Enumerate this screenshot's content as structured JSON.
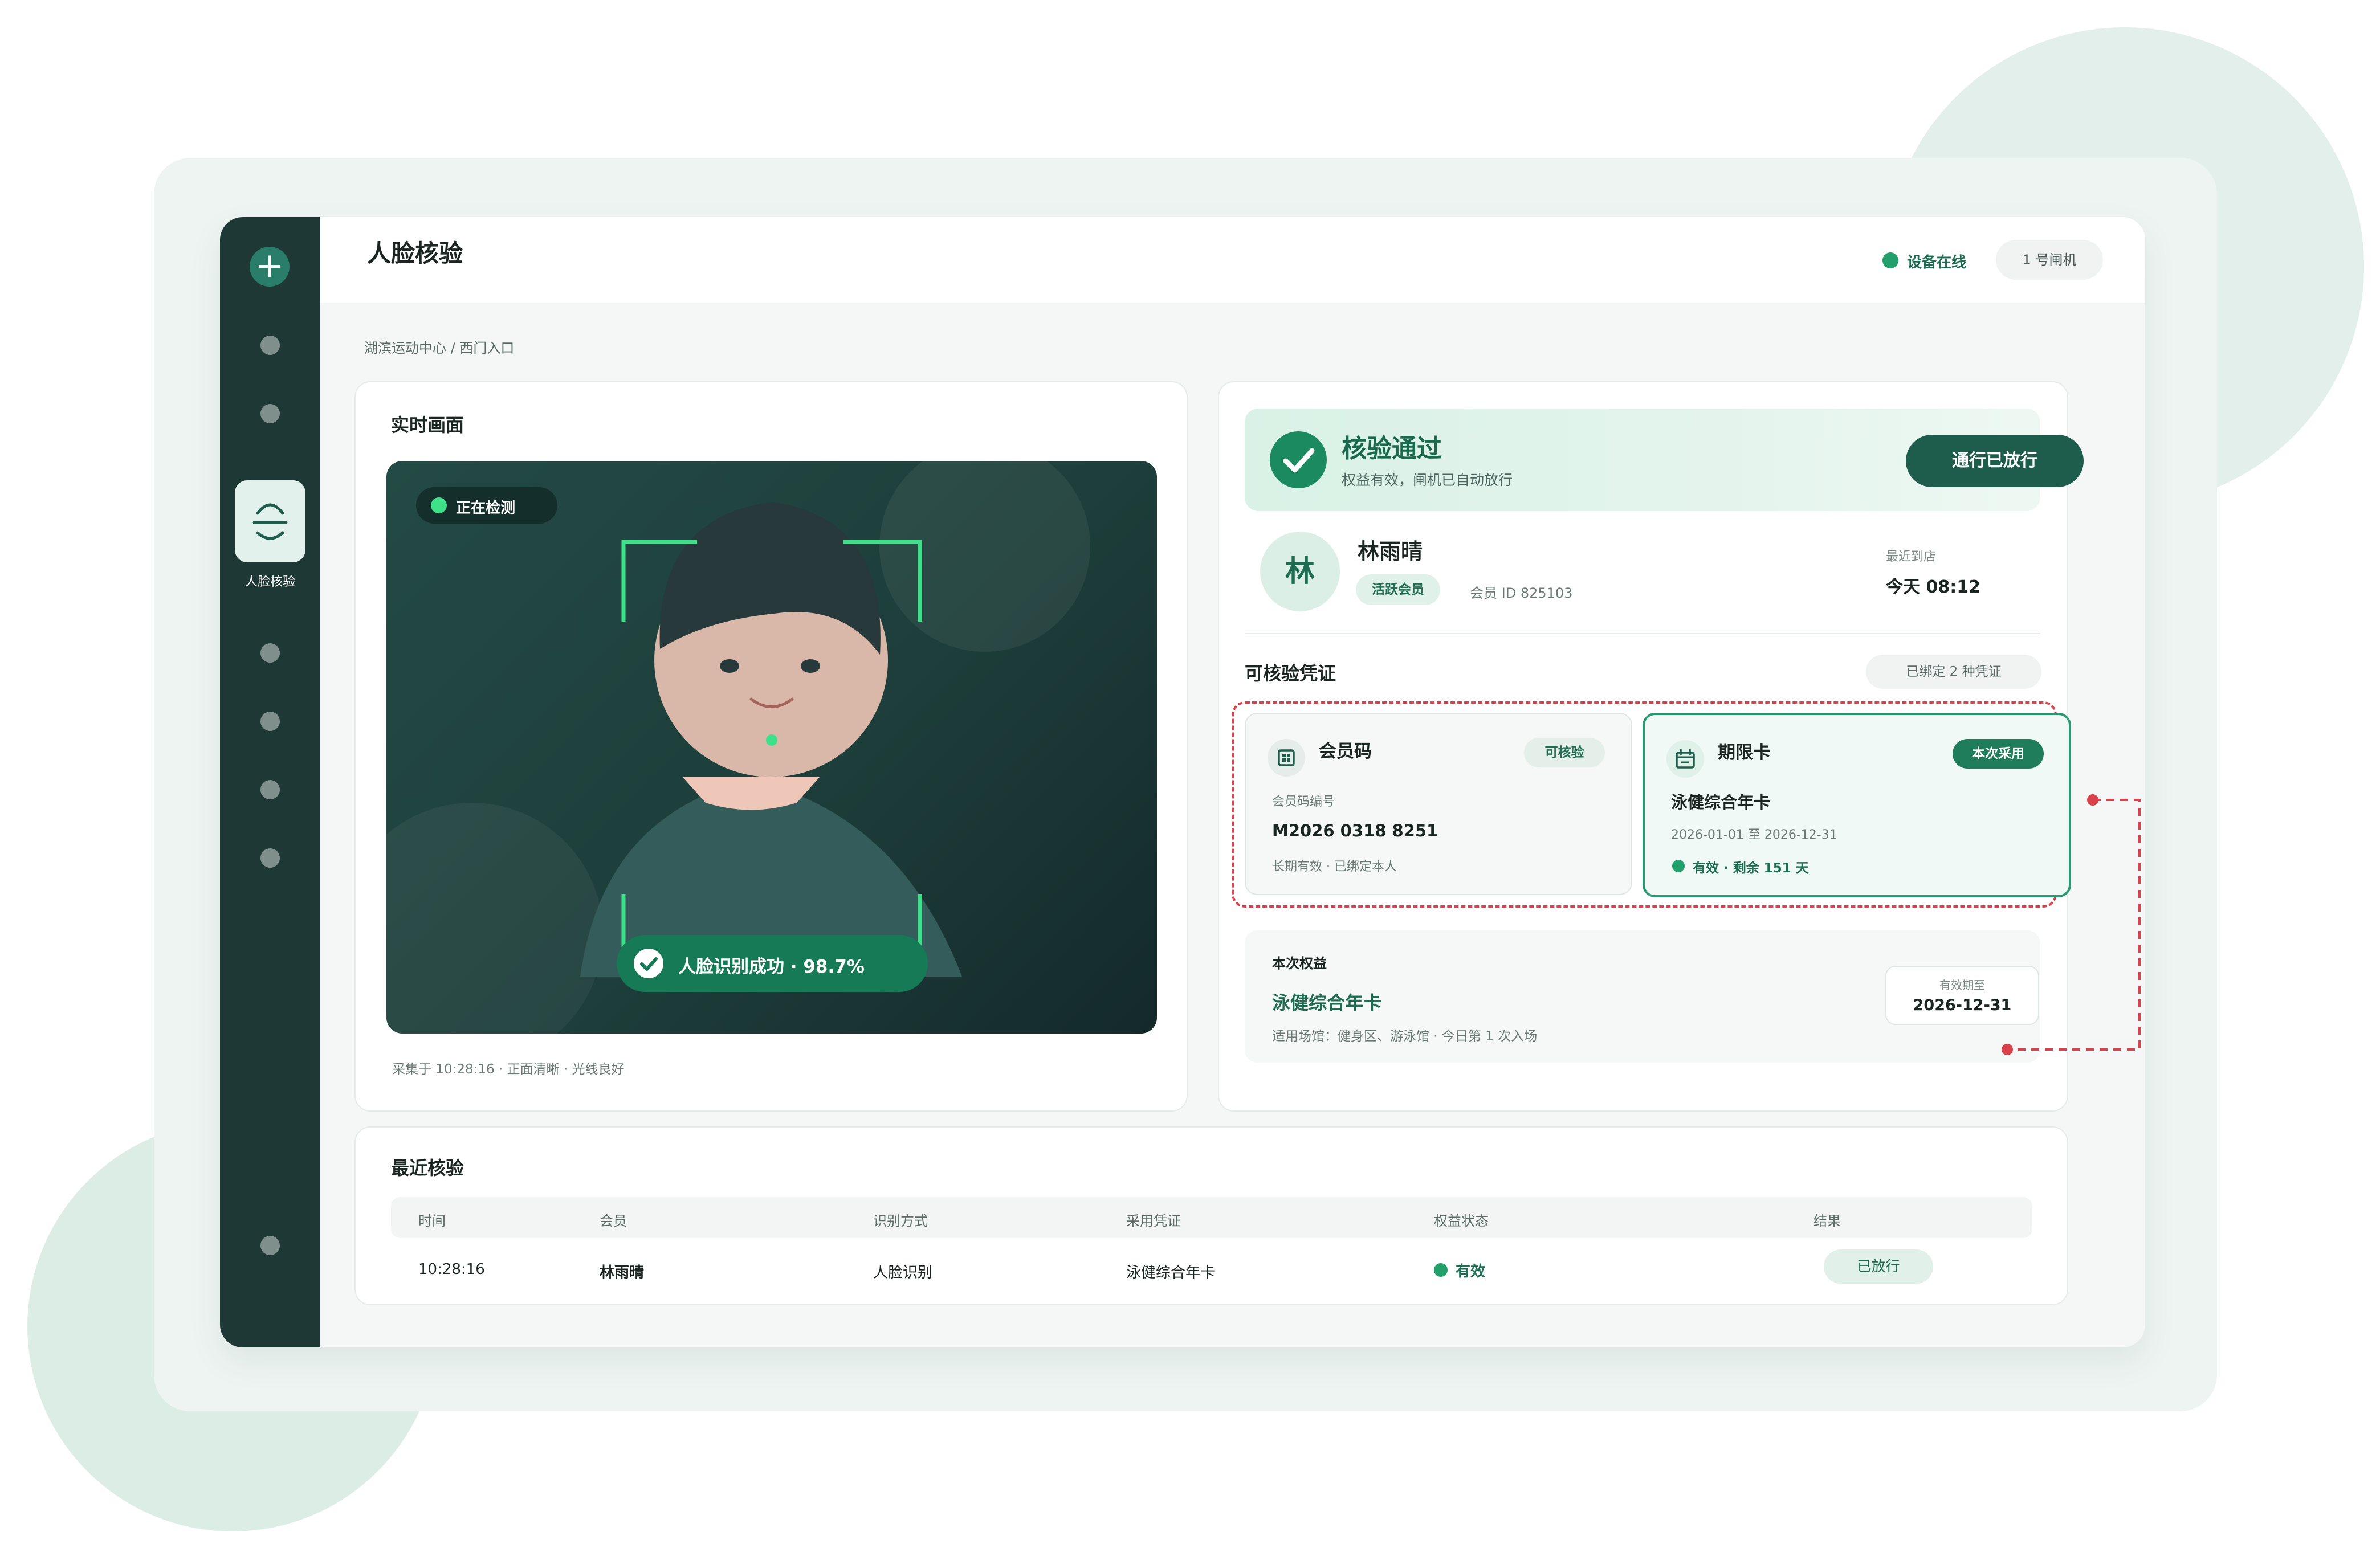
{
  "header": {
    "title": "人脸核验",
    "device_status": "设备在线",
    "gate": "1 号闸机"
  },
  "sidebar": {
    "active_label": "人脸核验"
  },
  "breadcrumb": "湖滨运动中心 / 西门入口",
  "live": {
    "title": "实时画面",
    "detecting": "正在检测",
    "success": "人脸识别成功 · 98.7%",
    "confidence_percent": 98.7,
    "caption": "采集于 10:28:16 · 正面清晰 · 光线良好"
  },
  "result": {
    "title": "核验通过",
    "subtitle": "权益有效，闸机已自动放行",
    "button": "通行已放行"
  },
  "member": {
    "avatar_initial": "林",
    "name": "林雨晴",
    "badge": "活跃会员",
    "id": "会员 ID 825103",
    "last_visit_label": "最近到店",
    "last_visit_value": "今天 08:12"
  },
  "credentials": {
    "title": "可核验凭证",
    "bound": "已绑定 2 种凭证",
    "member_code": {
      "name": "会员码",
      "badge": "可核验",
      "number_label": "会员码编号",
      "number": "M2026 0318 8251",
      "note": "长期有效 · 已绑定本人"
    },
    "period_card": {
      "name": "期限卡",
      "badge": "本次采用",
      "product": "泳健综合年卡",
      "range": "2026-01-01 至 2026-12-31",
      "status": "有效 · 剩余 151 天"
    }
  },
  "rights": {
    "label": "本次权益",
    "name": "泳健综合年卡",
    "venues": "适用场馆：健身区、游泳馆 · 今日第 1 次入场",
    "expiry_label": "有效期至",
    "expiry_value": "2026-12-31"
  },
  "recent": {
    "title": "最近核验",
    "columns": [
      "时间",
      "会员",
      "识别方式",
      "采用凭证",
      "权益状态",
      "结果"
    ],
    "rows": [
      {
        "time": "10:28:16",
        "member": "林雨晴",
        "method": "人脸识别",
        "credential": "泳健综合年卡",
        "status": "有效",
        "result": "已放行"
      }
    ]
  },
  "colors": {
    "sidebar": "#1e3835",
    "accent": "#1f7d5c",
    "annotation": "#d9424a"
  }
}
